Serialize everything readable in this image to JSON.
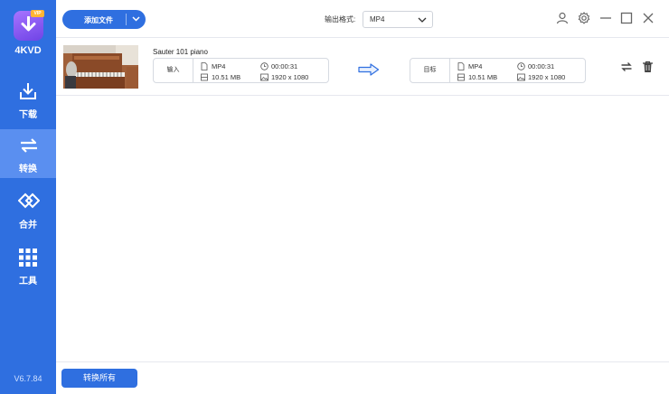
{
  "app": {
    "name": "4KVD",
    "badge": "VIP",
    "version": "V6.7.84"
  },
  "sidebar": {
    "items": [
      {
        "label": "下载",
        "icon": "download-icon",
        "active": false
      },
      {
        "label": "转换",
        "icon": "convert-icon",
        "active": true
      },
      {
        "label": "合并",
        "icon": "merge-icon",
        "active": false
      },
      {
        "label": "工具",
        "icon": "tools-grid-icon",
        "active": false
      }
    ]
  },
  "toolbar": {
    "add_file_label": "添加文件",
    "output_format_label": "输出格式:",
    "output_format_value": "MP4",
    "icons": [
      "user-icon",
      "settings-icon",
      "minimize-icon",
      "maximize-icon",
      "close-icon"
    ]
  },
  "files": [
    {
      "title": "Sauter 101 piano",
      "input": {
        "tag": "输入",
        "format": "MP4",
        "duration": "00:00:31",
        "size": "10.51 MB",
        "resolution": "1920 x 1080"
      },
      "output": {
        "tag": "目标",
        "format": "MP4",
        "duration": "00:00:31",
        "size": "10.51 MB",
        "resolution": "1920 x 1080"
      }
    }
  ],
  "footer": {
    "convert_all_label": "转换所有"
  },
  "colors": {
    "sidebar": "#2f6fe0",
    "sidebar_active": "#5a8ff0",
    "accent": "#2f6fe0",
    "logo_start": "#a774ff",
    "logo_end": "#6f44e6",
    "badge": "#ffb533"
  }
}
